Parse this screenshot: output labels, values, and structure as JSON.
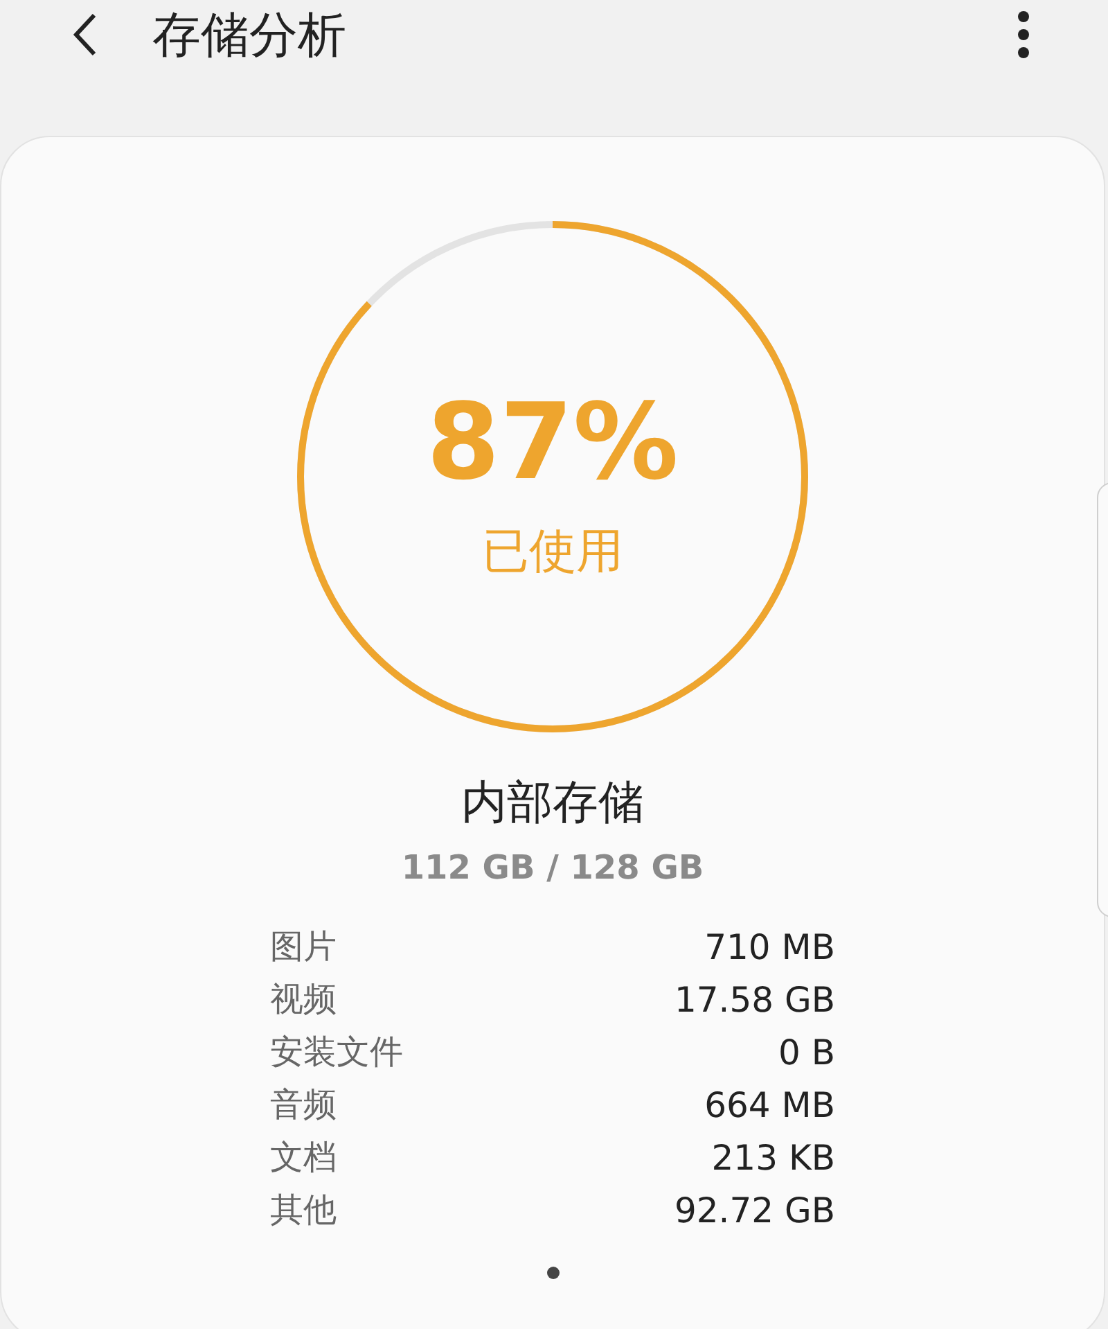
{
  "header": {
    "title": "存储分析"
  },
  "storage_card": {
    "level": 0.87,
    "percent": "87%",
    "used_label": "已使用",
    "name": "内部存储",
    "usage": "112 GB / 128 GB",
    "rows": [
      {
        "label": "图片",
        "value": "710 MB"
      },
      {
        "label": "视频",
        "value": "17.58 GB"
      },
      {
        "label": "安装文件",
        "value": "0 B"
      },
      {
        "label": "音频",
        "value": "664 MB"
      },
      {
        "label": "文档",
        "value": "213 KB"
      },
      {
        "label": "其他",
        "value": "92.72 GB"
      }
    ]
  }
}
